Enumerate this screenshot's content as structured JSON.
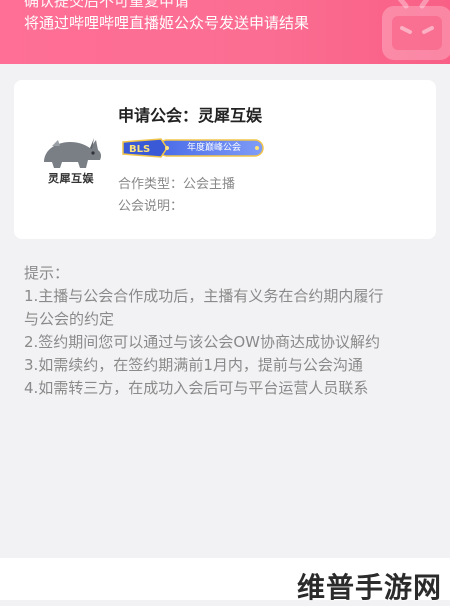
{
  "header": {
    "line1": "确认提交后不可重复申请",
    "line2": "将通过哔哩哔哩直播姬公众号发送申请结果"
  },
  "card": {
    "logo_text": "灵犀互娱",
    "title": "申请公会：灵犀互娱",
    "badge_text": "年度巅峰公会",
    "coop_type": "合作类型：公会主播",
    "description": "公会说明："
  },
  "tips": {
    "heading": "提示：",
    "lines": [
      "1.主播与公会合作成功后，主播有义务在合约期内履行",
      "与公会的约定",
      "2.签约期间您可以通过与该公会OW协商达成协议解约",
      "3.如需续约，在签约期满前1月内，提前与公会沟通",
      "4.如需转三方，在成功入会后可与平台运营人员联系"
    ]
  },
  "watermark": "维普手游网",
  "colors": {
    "header": "#fb6d92",
    "badge": "#5a7cf0",
    "tips_text": "#8a8a8a"
  }
}
